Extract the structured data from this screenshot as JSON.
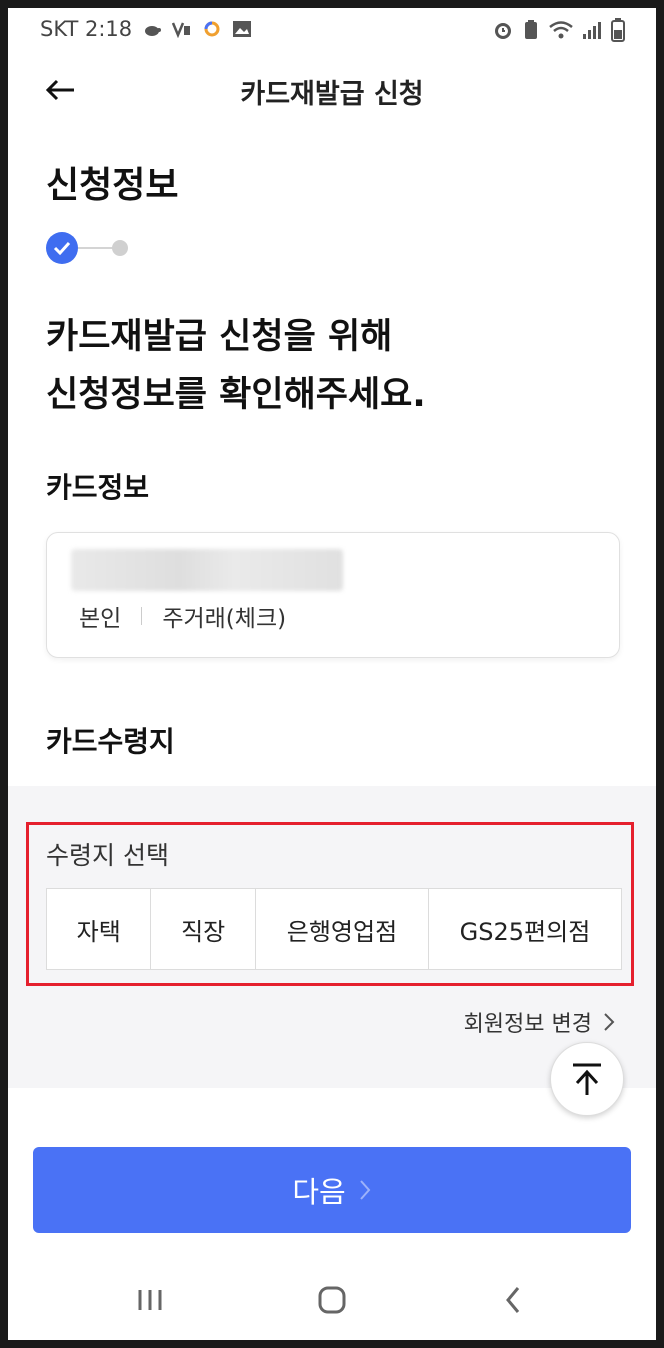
{
  "status_bar": {
    "carrier_time": "SKT 2:18"
  },
  "header": {
    "title": "카드재발급 신청",
    "back_icon": "arrow-left-icon"
  },
  "page": {
    "heading": "신청정보",
    "intro_line1": "카드재발급 신청을 위해",
    "intro_line2": "신청정보를 확인해주세요."
  },
  "card_info": {
    "title": "카드정보",
    "owner": "본인",
    "type": "주거래(체크)"
  },
  "receive": {
    "title": "카드수령지",
    "select_label": "수령지 선택",
    "options": [
      "자택",
      "직장",
      "은행영업점",
      "GS25편의점"
    ]
  },
  "member_link": "회원정보 변경",
  "next_button": "다음",
  "colors": {
    "primary": "#4a72f5",
    "highlight": "#e5202e"
  }
}
